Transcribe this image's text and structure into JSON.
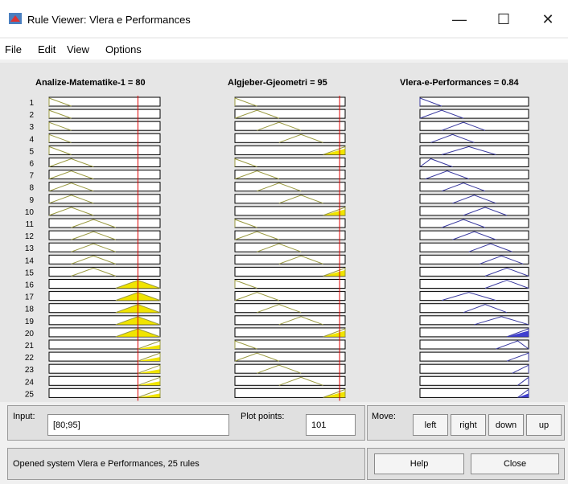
{
  "window": {
    "title": "Rule Viewer: Vlera e Performances",
    "minimize": "—",
    "maximize": "☐",
    "close": "✕"
  },
  "menu": [
    "File",
    "Edit",
    "View",
    "Options"
  ],
  "columns": [
    "Analize-Matematike-1 = 80",
    "Algjeber-Gjeometri = 95",
    "Vlera-e-Performances = 0.84"
  ],
  "rule_numbers": [
    "1",
    "2",
    "3",
    "4",
    "5",
    "6",
    "7",
    "8",
    "9",
    "10",
    "11",
    "12",
    "13",
    "14",
    "15",
    "16",
    "17",
    "18",
    "19",
    "20",
    "21",
    "22",
    "23",
    "24",
    "25"
  ],
  "inputs": {
    "analize": 80,
    "algjeber": 95
  },
  "rules": [
    {
      "a": [
        0,
        0,
        20
      ],
      "b": [
        0,
        0,
        20
      ],
      "o": [
        0,
        0,
        0.2
      ],
      "fa": 0.0,
      "fb": 0.0,
      "fo": 0.0
    },
    {
      "a": [
        0,
        0,
        20
      ],
      "b": [
        0,
        20,
        40
      ],
      "o": [
        0,
        0.2,
        0.4
      ],
      "fa": 0.0,
      "fb": 0.0,
      "fo": 0.0
    },
    {
      "a": [
        0,
        0,
        20
      ],
      "b": [
        20,
        40,
        60
      ],
      "o": [
        0.2,
        0.4,
        0.6
      ],
      "fa": 0.0,
      "fb": 0.0,
      "fo": 0.0
    },
    {
      "a": [
        0,
        0,
        20
      ],
      "b": [
        40,
        60,
        80
      ],
      "o": [
        0.1,
        0.3,
        0.5
      ],
      "fa": 0.0,
      "fb": 0.0,
      "fo": 0.0
    },
    {
      "a": [
        0,
        0,
        20
      ],
      "b": [
        80,
        100,
        100
      ],
      "o": [
        0.2,
        0.45,
        0.7
      ],
      "fa": 0.0,
      "fb": 0.75,
      "fo": 0.0
    },
    {
      "a": [
        0,
        20,
        40
      ],
      "b": [
        0,
        0,
        20
      ],
      "o": [
        0,
        0.1,
        0.3
      ],
      "fa": 0.0,
      "fb": 0.0,
      "fo": 0.0
    },
    {
      "a": [
        0,
        20,
        40
      ],
      "b": [
        0,
        20,
        40
      ],
      "o": [
        0.05,
        0.25,
        0.45
      ],
      "fa": 0.0,
      "fb": 0.0,
      "fo": 0.0
    },
    {
      "a": [
        0,
        20,
        40
      ],
      "b": [
        20,
        40,
        60
      ],
      "o": [
        0.2,
        0.4,
        0.6
      ],
      "fa": 0.0,
      "fb": 0.0,
      "fo": 0.0
    },
    {
      "a": [
        0,
        20,
        40
      ],
      "b": [
        40,
        60,
        80
      ],
      "o": [
        0.3,
        0.5,
        0.7
      ],
      "fa": 0.0,
      "fb": 0.0,
      "fo": 0.0
    },
    {
      "a": [
        0,
        20,
        40
      ],
      "b": [
        80,
        100,
        100
      ],
      "o": [
        0.4,
        0.6,
        0.8
      ],
      "fa": 0.0,
      "fb": 0.75,
      "fo": 0.0
    },
    {
      "a": [
        20,
        40,
        60
      ],
      "b": [
        0,
        0,
        20
      ],
      "o": [
        0.2,
        0.4,
        0.6
      ],
      "fa": 0.0,
      "fb": 0.0,
      "fo": 0.0
    },
    {
      "a": [
        20,
        40,
        60
      ],
      "b": [
        0,
        20,
        40
      ],
      "o": [
        0.3,
        0.5,
        0.7
      ],
      "fa": 0.0,
      "fb": 0.0,
      "fo": 0.0
    },
    {
      "a": [
        20,
        40,
        60
      ],
      "b": [
        20,
        40,
        60
      ],
      "o": [
        0.45,
        0.65,
        0.85
      ],
      "fa": 0.0,
      "fb": 0.0,
      "fo": 0.0
    },
    {
      "a": [
        20,
        40,
        60
      ],
      "b": [
        40,
        60,
        80
      ],
      "o": [
        0.55,
        0.75,
        0.95
      ],
      "fa": 0.0,
      "fb": 0.0,
      "fo": 0.0
    },
    {
      "a": [
        20,
        40,
        60
      ],
      "b": [
        80,
        100,
        100
      ],
      "o": [
        0.6,
        0.8,
        1.0
      ],
      "fa": 0.0,
      "fb": 0.75,
      "fo": 0.0
    },
    {
      "a": [
        60,
        80,
        100
      ],
      "b": [
        0,
        0,
        20
      ],
      "o": [
        0.6,
        0.8,
        1.0
      ],
      "fa": 1.0,
      "fb": 0.0,
      "fo": 0.0
    },
    {
      "a": [
        60,
        80,
        100
      ],
      "b": [
        0,
        20,
        40
      ],
      "o": [
        0.2,
        0.45,
        0.7
      ],
      "fa": 1.0,
      "fb": 0.0,
      "fo": 0.0
    },
    {
      "a": [
        60,
        80,
        100
      ],
      "b": [
        20,
        40,
        60
      ],
      "o": [
        0.4,
        0.6,
        0.8
      ],
      "fa": 1.0,
      "fb": 0.0,
      "fo": 0.0
    },
    {
      "a": [
        60,
        80,
        100
      ],
      "b": [
        40,
        60,
        80
      ],
      "o": [
        0.5,
        0.75,
        1.0
      ],
      "fa": 1.0,
      "fb": 0.0,
      "fo": 0.0
    },
    {
      "a": [
        60,
        80,
        100
      ],
      "b": [
        80,
        100,
        100
      ],
      "o": [
        0.8,
        1.0,
        1.0
      ],
      "fa": 1.0,
      "fb": 0.75,
      "fo": 0.75
    },
    {
      "a": [
        80,
        100,
        100
      ],
      "b": [
        0,
        0,
        20
      ],
      "o": [
        0.7,
        0.9,
        1.0
      ],
      "fa": 0.5,
      "fb": 0.0,
      "fo": 0.0
    },
    {
      "a": [
        80,
        100,
        100
      ],
      "b": [
        0,
        20,
        40
      ],
      "o": [
        0.8,
        1.0,
        1.0
      ],
      "fa": 0.5,
      "fb": 0.0,
      "fo": 0.0
    },
    {
      "a": [
        80,
        100,
        100
      ],
      "b": [
        20,
        40,
        60
      ],
      "o": [
        0.85,
        1.0,
        1.0
      ],
      "fa": 0.5,
      "fb": 0.0,
      "fo": 0.0
    },
    {
      "a": [
        80,
        100,
        100
      ],
      "b": [
        40,
        60,
        80
      ],
      "o": [
        0.9,
        1.0,
        1.0
      ],
      "fa": 0.5,
      "fb": 0.0,
      "fo": 0.0
    },
    {
      "a": [
        80,
        100,
        100
      ],
      "b": [
        80,
        100,
        100
      ],
      "o": [
        0.9,
        1.0,
        1.0
      ],
      "fa": 0.5,
      "fb": 0.75,
      "fo": 0.5
    }
  ],
  "controls": {
    "input_label": "Input:",
    "input_value": "[80;95]",
    "plot_points_label": "Plot points:",
    "plot_points_value": "101",
    "move_label": "Move:",
    "left": "left",
    "right": "right",
    "down": "down",
    "up": "up",
    "status": "Opened system Vlera e Performances, 25 rules",
    "help": "Help",
    "close": "Close"
  }
}
